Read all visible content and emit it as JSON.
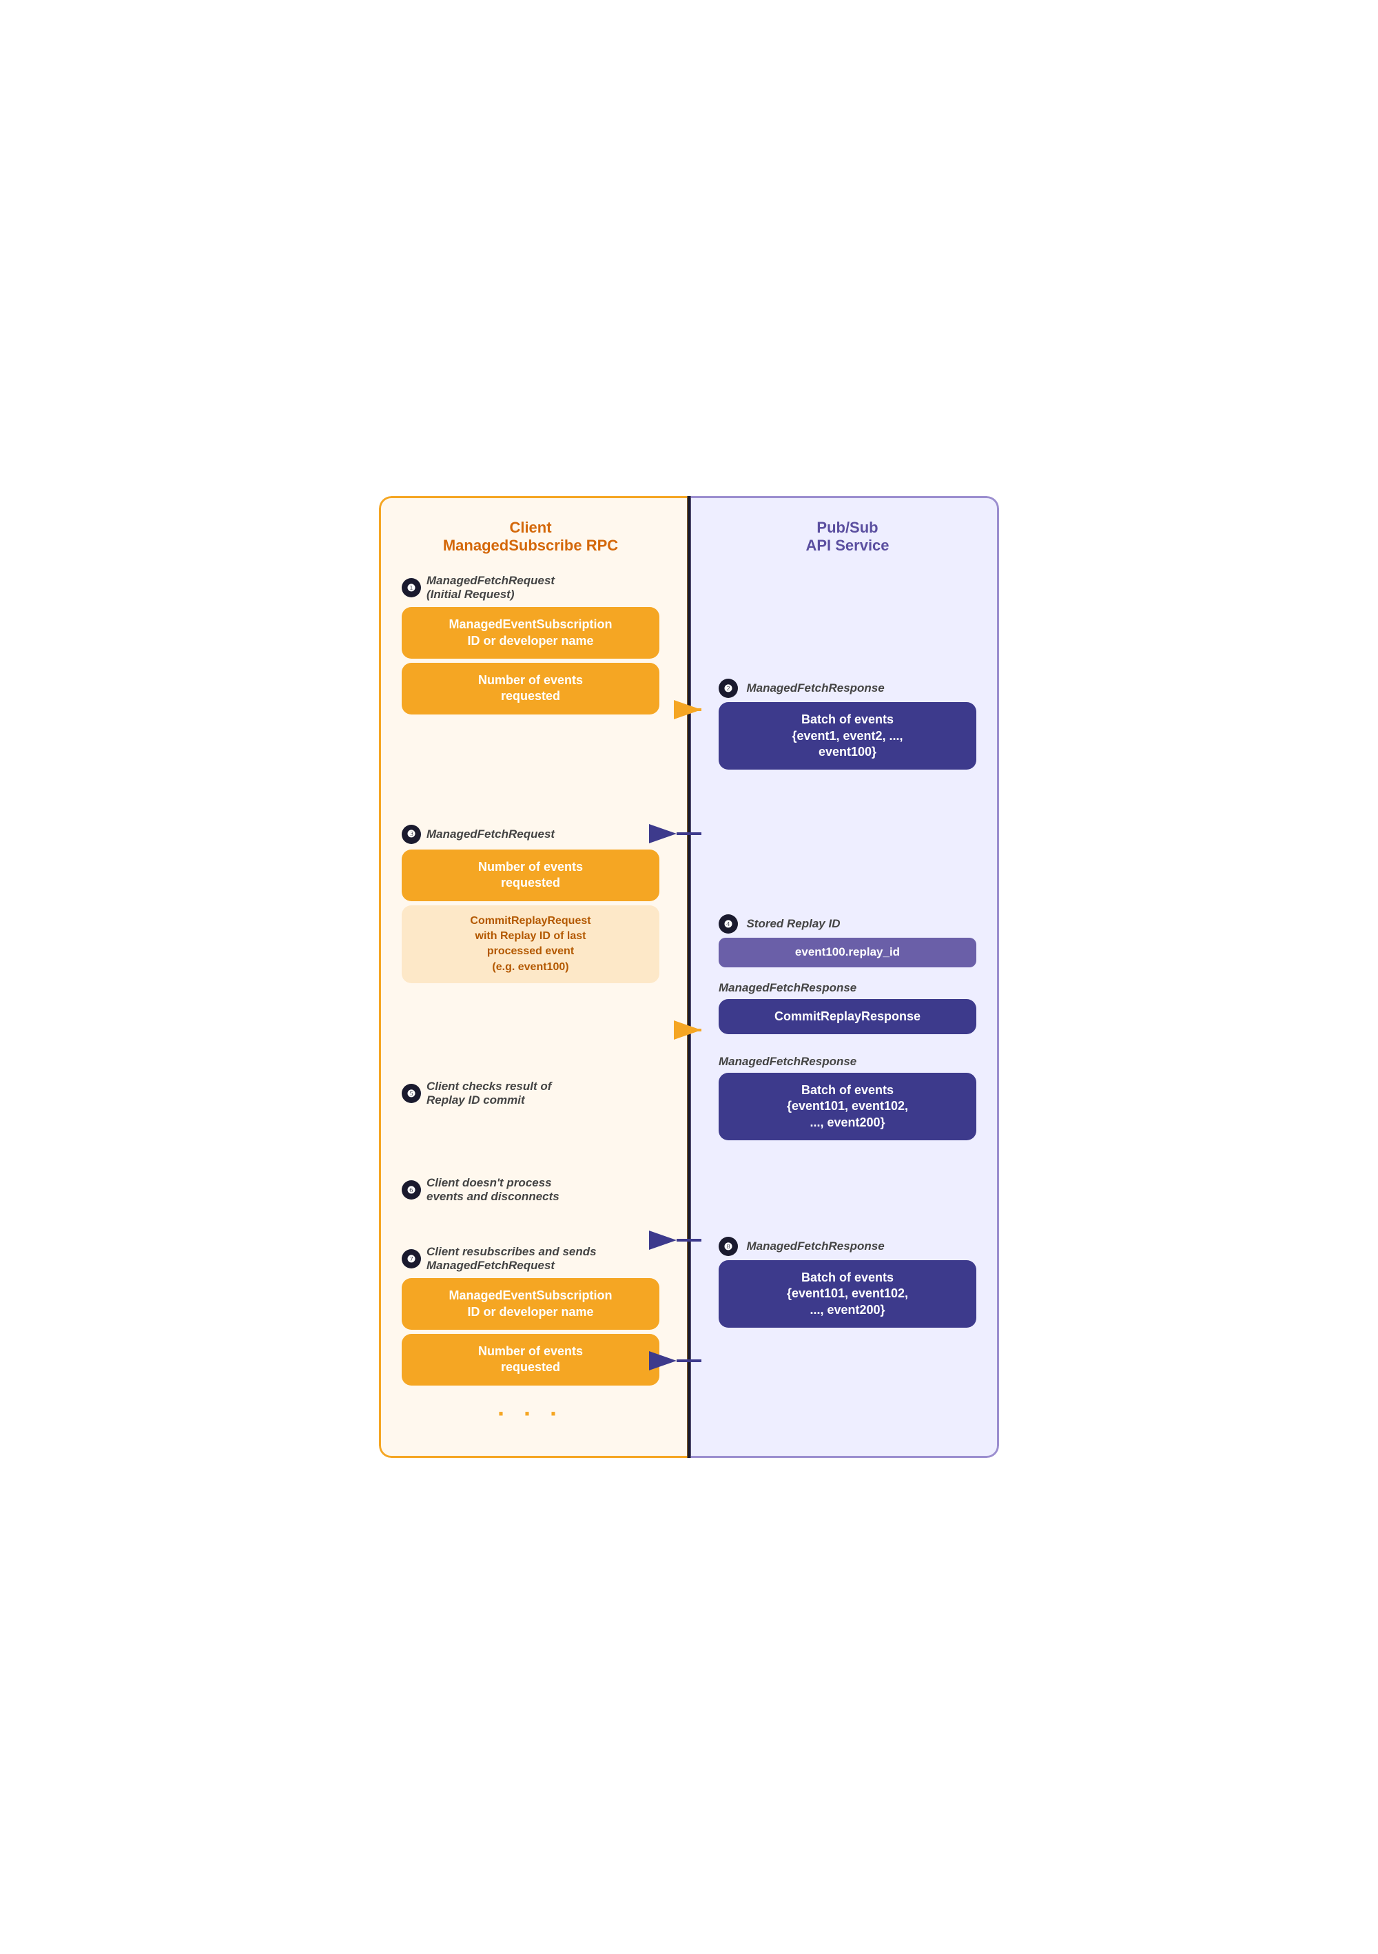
{
  "left_header": {
    "line1": "Client",
    "line2": "ManagedSubscribe RPC"
  },
  "right_header": {
    "line1": "Pub/Sub",
    "line2": "API Service"
  },
  "steps": [
    {
      "id": "1",
      "side": "left",
      "label": "ManagedFetchRequest",
      "sublabel": "(Initial Request)",
      "boxes": [
        {
          "type": "orange",
          "text": "ManagedEventSubscription ID or developer name"
        },
        {
          "type": "orange",
          "text": "Number of events requested"
        }
      ],
      "arrow": "right"
    },
    {
      "id": "2",
      "side": "right",
      "label": "ManagedFetchResponse",
      "boxes": [
        {
          "type": "purple",
          "text": "Batch of events {event1, event2, ..., event100}"
        }
      ],
      "arrow": "left"
    },
    {
      "id": "3",
      "side": "left",
      "label": "ManagedFetchRequest",
      "boxes": [
        {
          "type": "orange",
          "text": "Number of events requested"
        },
        {
          "type": "orange-light",
          "text": "CommitReplayRequest with Replay ID of last processed event (e.g. event100)"
        }
      ],
      "arrow": "right"
    },
    {
      "id": "4",
      "side": "right",
      "label": "Stored Replay ID",
      "boxes": [
        {
          "type": "purple-light",
          "text": "event100.replay_id"
        }
      ]
    },
    {
      "id": "5",
      "side": "left",
      "label": "Client checks result of Replay ID commit",
      "boxes": [],
      "arrow": "left",
      "right_prefix": {
        "label": "ManagedFetchResponse",
        "box": "CommitReplayResponse"
      }
    },
    {
      "id": "6",
      "side": "left",
      "label": "Client doesn't process events and disconnects",
      "boxes": [],
      "arrow": "left",
      "right_prefix": {
        "label": "ManagedFetchResponse",
        "box": "Batch of events {event101, event102, ..., event200}"
      }
    },
    {
      "id": "7",
      "side": "left",
      "label": "Client resubscribes and sends ManagedFetchRequest",
      "boxes": [
        {
          "type": "orange",
          "text": "ManagedEventSubscription ID or developer name"
        },
        {
          "type": "orange",
          "text": "Number of events requested"
        }
      ],
      "arrow": "right"
    },
    {
      "id": "8",
      "side": "right",
      "label": "ManagedFetchResponse",
      "boxes": [
        {
          "type": "purple",
          "text": "Batch of events {event101, event102, ..., event200}"
        }
      ],
      "arrow": "left"
    }
  ],
  "dots": "..."
}
